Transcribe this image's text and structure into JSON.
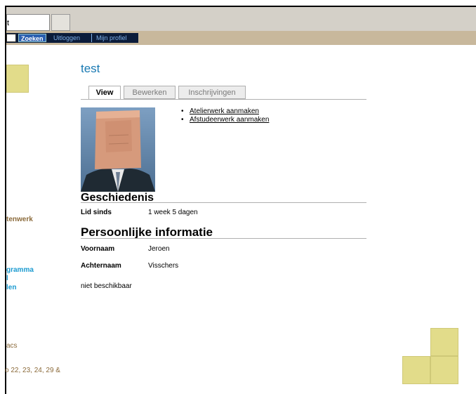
{
  "browser": {
    "address_text": "t"
  },
  "nav": {
    "search_button": "Zoeken",
    "logout": "Uitloggen",
    "profile": "Mijn profiel"
  },
  "sidebar": {
    "item_werk": "tenwerk",
    "items_blue": [
      "gramma",
      "l",
      "len"
    ],
    "item_acs": "acs",
    "item_dates": "o 22, 23, 24, 29 &"
  },
  "page": {
    "title": "test",
    "tabs": [
      {
        "label": "View",
        "active": true
      },
      {
        "label": "Bewerken",
        "active": false
      },
      {
        "label": "Inschrijvingen",
        "active": false
      }
    ],
    "actions": [
      "Atelierwerk aanmaken",
      "Afstudeerwerk aanmaken"
    ],
    "history": {
      "heading": "Geschiedenis",
      "member_since_label": "Lid sinds",
      "member_since_value": "1 week 5 dagen"
    },
    "personal": {
      "heading": "Persoonlijke informatie",
      "firstname_label": "Voornaam",
      "firstname_value": "Jeroen",
      "lastname_label": "Achternaam",
      "lastname_value": "Visschers",
      "unavailable": "niet beschikbaar"
    }
  },
  "colors": {
    "title_blue": "#1a7ab3",
    "nav_bar": "#c8b89c",
    "nav_dark": "#0b1c3a",
    "sticky_note": "#e2dc8a",
    "sidebar_brown": "#8b6a3a",
    "sidebar_blue": "#1a9ad0"
  }
}
